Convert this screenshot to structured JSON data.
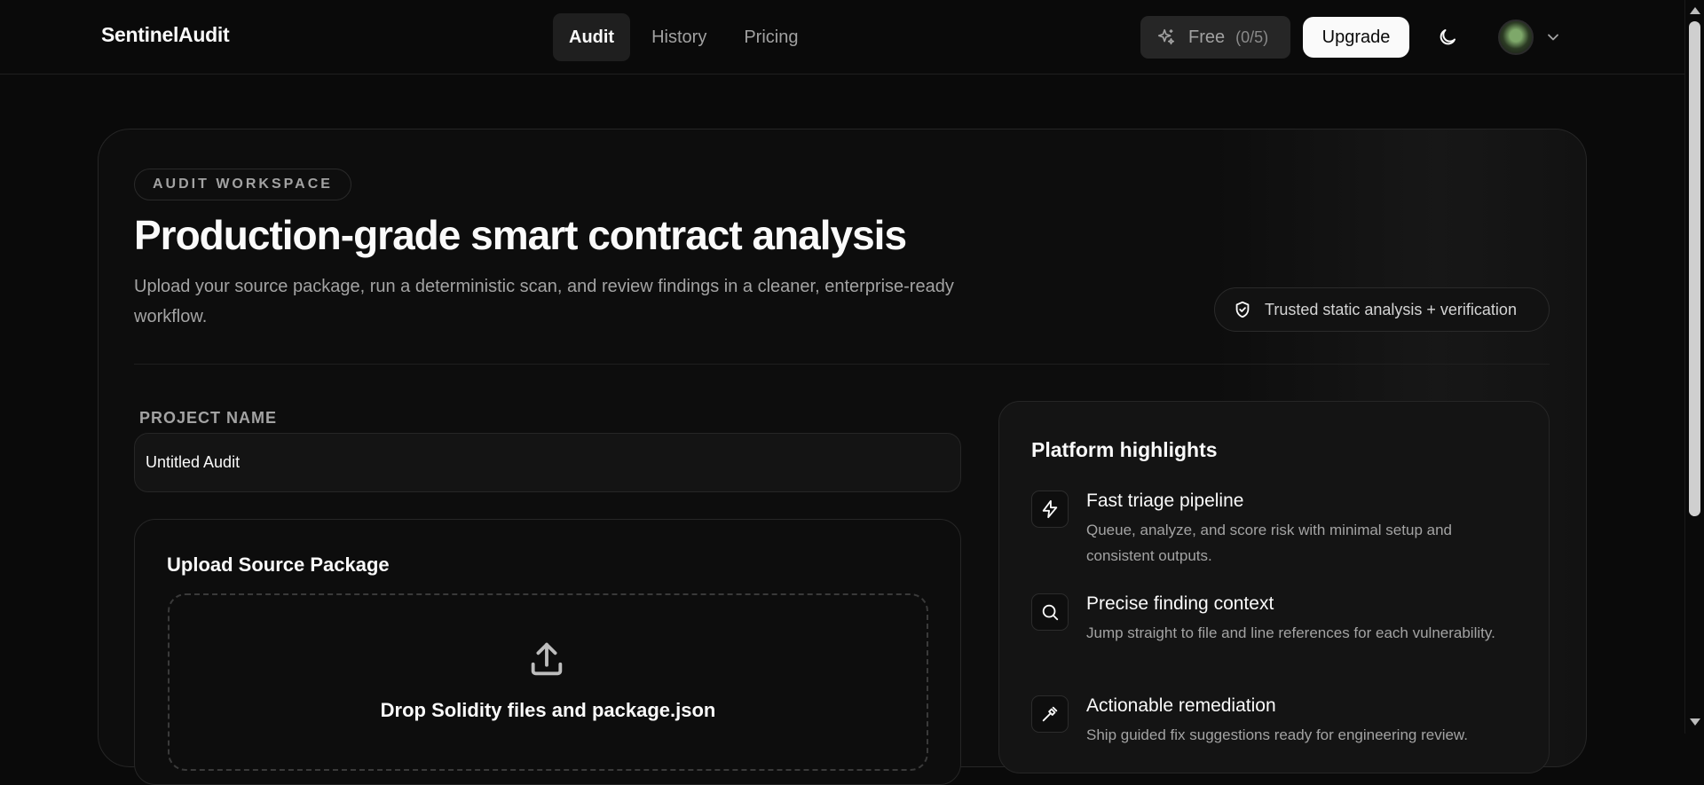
{
  "app": {
    "brand": "SentinelAudit"
  },
  "nav": {
    "tabs": [
      {
        "label": "Audit",
        "active": true
      },
      {
        "label": "History",
        "active": false
      },
      {
        "label": "Pricing",
        "active": false
      }
    ]
  },
  "account": {
    "plan_label": "Free",
    "usage": "(0/5)",
    "upgrade_label": "Upgrade",
    "plan_icon": "sparkles-icon",
    "theme_icon": "moon-icon",
    "avatar_menu_icon": "chevron-down-icon"
  },
  "hero": {
    "badge": "AUDIT WORKSPACE",
    "title": "Production-grade smart contract analysis",
    "subtitle": "Upload your source package, run a deterministic scan, and review findings in a cleaner, enterprise-ready workflow.",
    "trust_label": "Trusted static analysis + verification",
    "trust_icon": "shield-check-icon"
  },
  "form": {
    "project_label": "PROJECT NAME",
    "project_value": "Untitled Audit"
  },
  "upload": {
    "title": "Upload Source Package",
    "drop_text": "Drop Solidity files and package.json",
    "icon": "upload-icon"
  },
  "highlights": {
    "title": "Platform highlights",
    "items": [
      {
        "icon": "zap-icon",
        "title": "Fast triage pipeline",
        "desc": "Queue, analyze, and score risk with minimal setup and consistent outputs."
      },
      {
        "icon": "search-icon",
        "title": "Precise finding context",
        "desc": "Jump straight to file and line references for each vulnerability."
      },
      {
        "icon": "hammer-icon",
        "title": "Actionable remediation",
        "desc": "Ship guided fix suggestions ready for engineering review."
      }
    ]
  },
  "colors": {
    "background": "#0a0a0a",
    "card": "#0d0d0d",
    "border": "#262626",
    "text": "#fafafa",
    "muted": "#a3a3a3",
    "upgrade_bg": "#fafafa"
  }
}
